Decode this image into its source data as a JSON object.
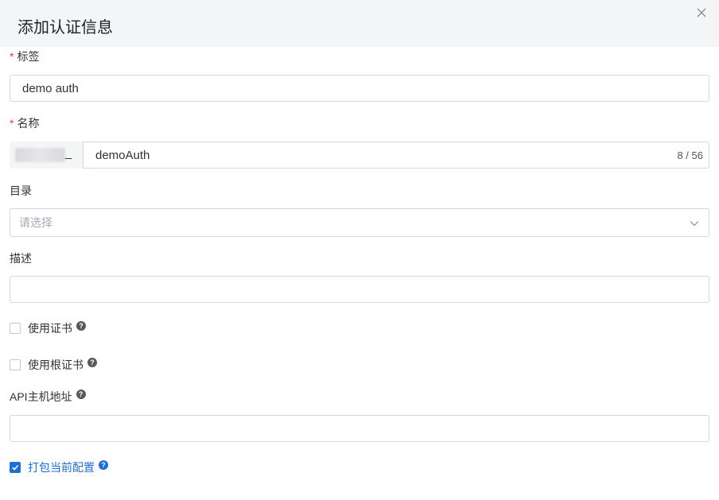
{
  "dialog": {
    "title": "添加认证信息"
  },
  "form": {
    "label_field": {
      "required_mark": "*",
      "label": "标签",
      "value": "demo auth"
    },
    "name_field": {
      "required_mark": "*",
      "label": "名称",
      "prefix_suffix": "_",
      "value": "demoAuth",
      "counter": "8 / 56"
    },
    "directory_field": {
      "label": "目录",
      "placeholder": "请选择"
    },
    "description_field": {
      "label": "描述",
      "value": ""
    },
    "use_certificate": {
      "label": "使用证书",
      "checked": false
    },
    "use_root_certificate": {
      "label": "使用根证书",
      "checked": false
    },
    "api_host_field": {
      "label": "API主机地址",
      "value": ""
    },
    "package_current_config": {
      "label": "打包当前配置",
      "checked": true
    },
    "help_glyph": "?"
  },
  "colors": {
    "accent": "#1d6fd6",
    "required": "#e2453c",
    "header_bg": "#f4f5f7",
    "border": "#d4d7de"
  },
  "icons": {
    "close": "close-icon",
    "chevron": "chevron-down-icon",
    "help": "question-circle-icon",
    "check": "checkmark-icon"
  }
}
